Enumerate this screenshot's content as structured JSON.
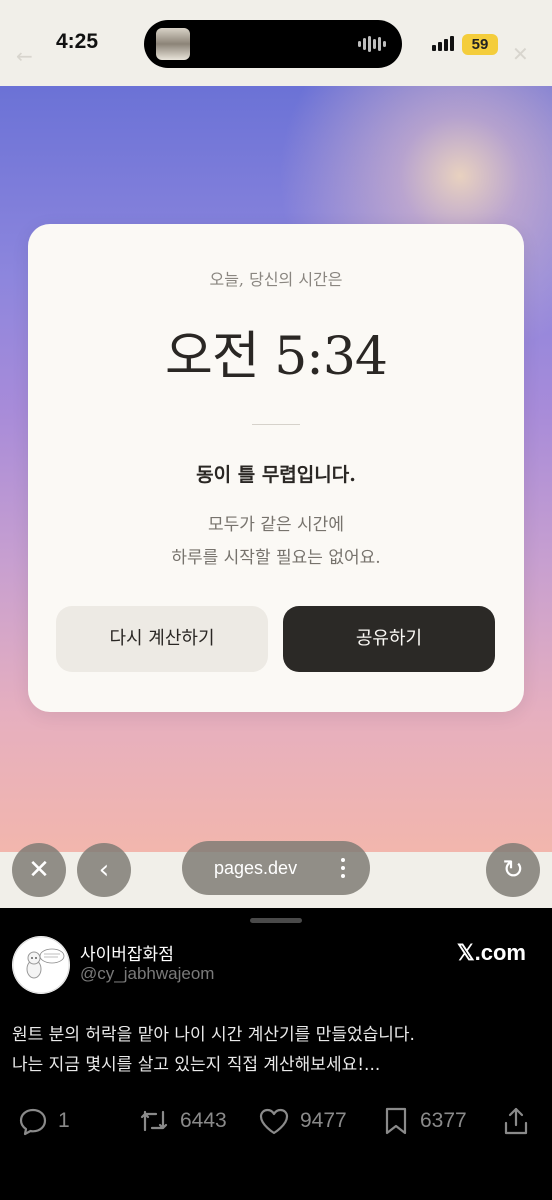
{
  "status_bar": {
    "time": "4:25",
    "battery": "59",
    "back_glyph": "←",
    "close_glyph": "✕"
  },
  "card": {
    "kicker": "오늘, 당신의 시간은",
    "time": "오전 5:34",
    "headline": "동이 틀 무렵입니다.",
    "desc_line1": "모두가 같은 시간에",
    "desc_line2": "하루를 시작할 필요는 없어요.",
    "retry_label": "다시 계산하기",
    "share_label": "공유하기"
  },
  "browser": {
    "url": "pages.dev",
    "close_glyph": "✕",
    "back_glyph": "‹",
    "reload_glyph": "↻"
  },
  "post": {
    "author_name": "사이버잡화점",
    "author_handle": "@cy_jabhwajeom",
    "source": "𝕏.com",
    "text_line1": "원트 분의 허락을 맡아 나이 시간 계산기를 만들었습니다.",
    "text_line2": "나는 지금 몇시를 살고 있는지 직접 계산해보세요!...",
    "replies": "1",
    "reposts": "6443",
    "likes": "9477",
    "bookmarks": "6377"
  },
  "colors": {
    "card_bg": "#fbf9f5",
    "share_button": "#2b2926",
    "retry_button": "#edeae4",
    "battery": "#f4cd3c"
  },
  "icons": [
    "signal-icon",
    "waveform-icon",
    "close-icon",
    "back-icon",
    "more-icon",
    "reload-icon",
    "reply-icon",
    "repost-icon",
    "like-icon",
    "bookmark-icon",
    "share-icon"
  ]
}
